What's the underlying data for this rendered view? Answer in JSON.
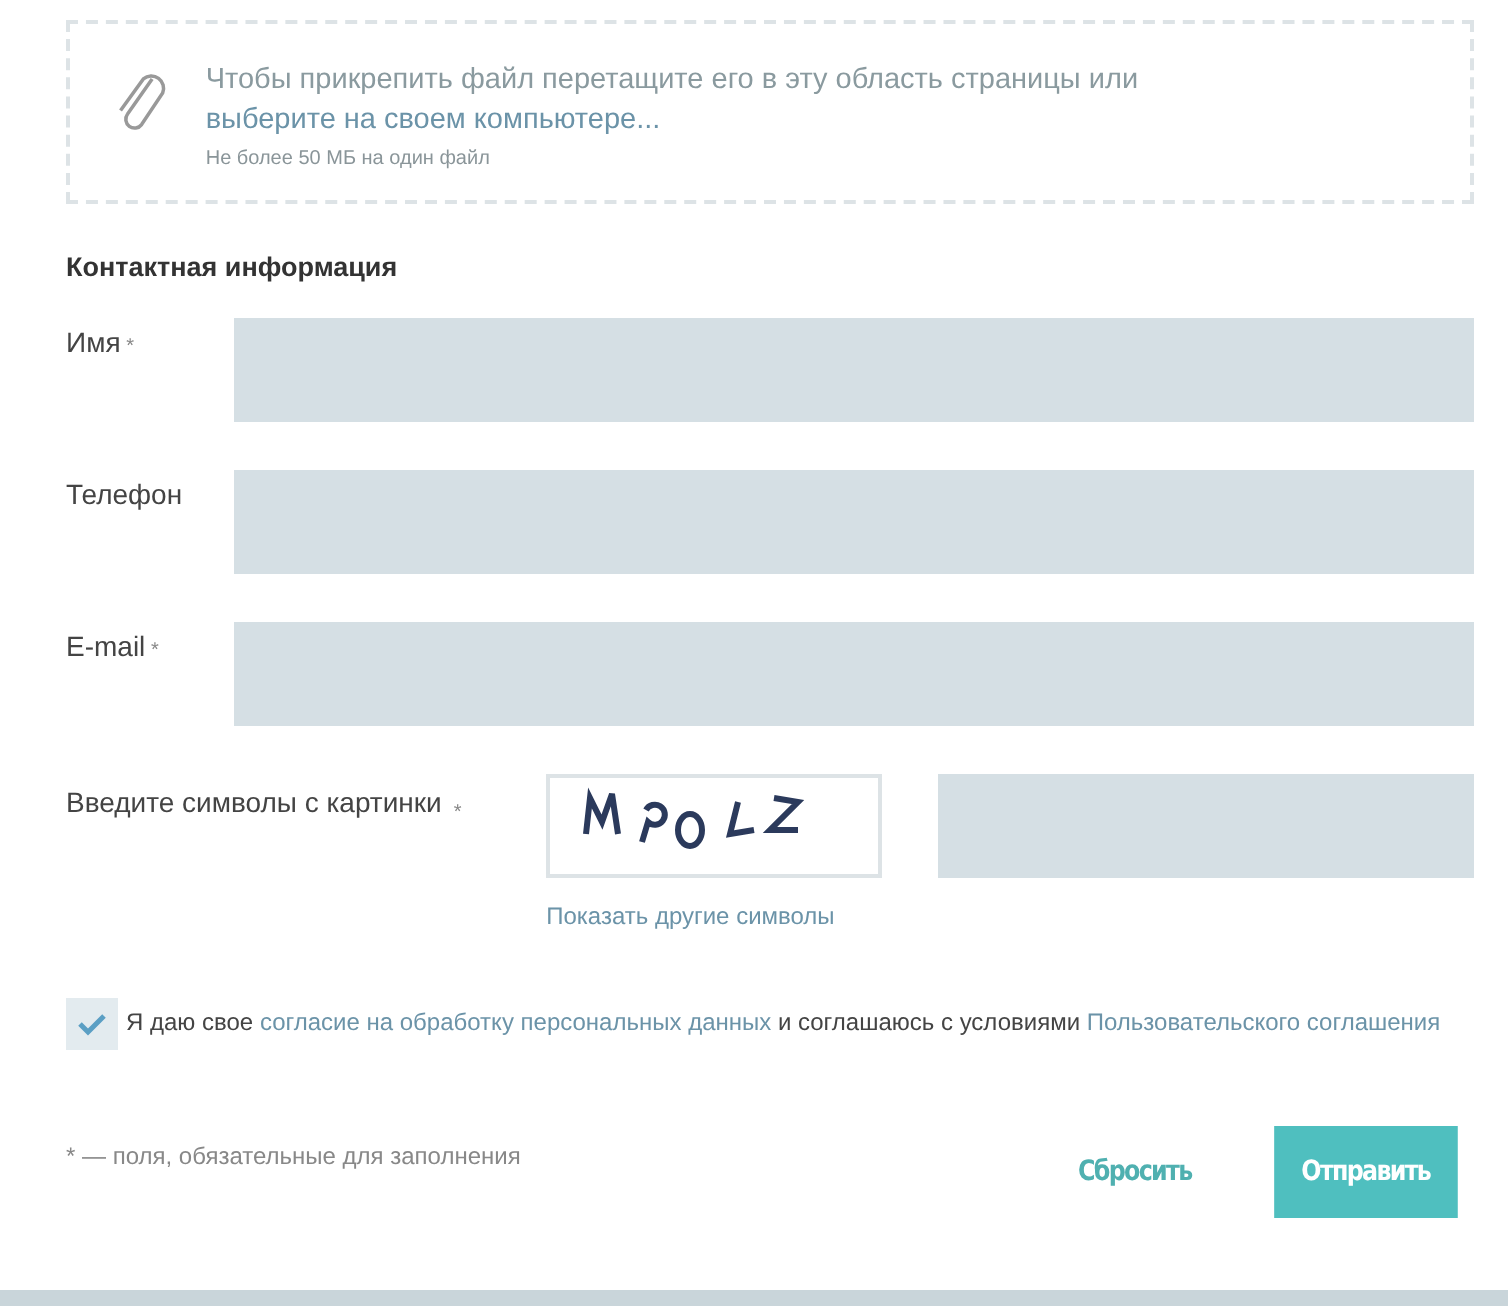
{
  "upload": {
    "text": "Чтобы прикрепить файл перетащите его в эту область страницы или ",
    "link": "выберите на своем компьютере...",
    "note": "Не более 50 МБ на один файл"
  },
  "section_title": "Контактная информация",
  "fields": [
    {
      "label": "Имя",
      "required_mark": "*"
    },
    {
      "label": "Телефон"
    },
    {
      "label": "E-mail",
      "required_mark": "*"
    }
  ],
  "captcha": {
    "label": "Введите символы с картинки",
    "required_mark": "*",
    "kind": "picture",
    "refresh_link": "Показать другие символы"
  },
  "consent": {
    "checked": true,
    "text_1": "Я даю свое ",
    "link_1": "согласие на обработку персональных данных",
    "text_2": " и соглашаюсь с условиями ",
    "link_2": "Пользовательского соглашения"
  },
  "required_note": {
    "mark": "*",
    "text": "— поля, обязательные для заполнения"
  },
  "buttons": [
    {
      "kind": "secondary",
      "label": "Сбросить"
    },
    {
      "kind": "primary",
      "label": "Отправить"
    }
  ]
}
